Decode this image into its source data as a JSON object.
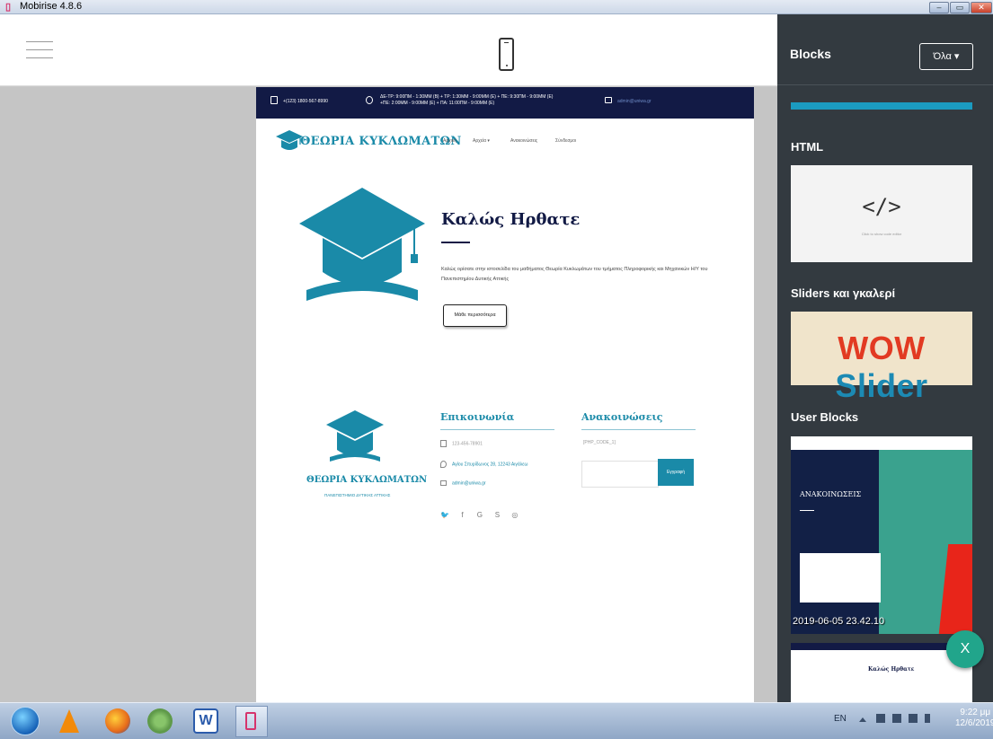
{
  "window": {
    "title": "Mobirise 4.8.6",
    "controls": [
      "minimize-icon",
      "maximize-icon",
      "close-icon"
    ]
  },
  "toolbar": {
    "menu_icon": "hamburger-icon",
    "preview_icon": "mobile-phone-icon"
  },
  "site": {
    "topbar": {
      "phone": "+(123) 1800-567-8990",
      "hours_line1": "ΔΕ-ΤΡ: 9:00ΠΜ - 1:30ΜΜ (Β) + ΤΡ: 1:30ΜΜ - 9:00ΜΜ (Ε) + ΠΕ: 9:30ΠΜ - 9:00ΜΜ (Ε)",
      "hours_line2": "+ΠΕ: 2:00ΜΜ - 9:00ΜΜ (Ε) + ΠΑ: 11:00ΠΜ - 9:00ΜΜ (Ε)",
      "email": "admin@uniwa.gr"
    },
    "brand": "ΘΕΩΡΙΑ ΚΥΚΛΩΜΑΤΩΝ",
    "nav": [
      "Αρχική",
      "Αρχεία ▾",
      "Ανακοινώσεις",
      "Σύνδεσμοι"
    ],
    "hero": {
      "title": "Καλώς Ηρθατε",
      "text": "Καλώς ορίσατε στην ιστοσελίδα του μαθήματος Θεωρία Κυκλωμάτων του τμήματος Πληροφορικής και Μηχανικών Η/Υ του Πανεπιστημίου Δυτικής Αττικής",
      "button": "Μάθε περισσότερα"
    },
    "footer": {
      "brand": "ΘΕΩΡΙΑ ΚΥΚΛΩΜΑΤΩΝ",
      "subtitle": "ΠΑΝΕΠΙΣΤΗΜΙΟ ΔΥΤΙΚΗΣ ΑΤΤΙΚΗΣ",
      "contact_heading": "Επικοινωνία",
      "news_heading": "Ανακοινώσεις",
      "phone": "123-456-78901",
      "address": "Αγίου Σπυρίδωνος 28, 12243 Αιγάλεω",
      "email": "admin@uniwa.gr",
      "news_code": "[PHP_CODE_1]",
      "news_button": "Εγγραφή",
      "social_icons": [
        "twitter-icon",
        "facebook-icon",
        "google-plus-icon",
        "skype-icon",
        "instagram-icon"
      ]
    }
  },
  "panel": {
    "title": "Blocks",
    "filter": "Όλα ▾",
    "sections": {
      "html": "HTML",
      "sliders": "Sliders και γκαλερί",
      "user": "User Blocks"
    },
    "html_card_icon": "</>",
    "html_card_hint": "Click to show code editor",
    "wow_word1": "WOW",
    "wow_word2": "Slider",
    "user_block1_heading": "ΑΝΑΚΟΙΝΩΣΕΙΣ",
    "user_block1_stamp": "2019-06-05 23.42.10",
    "user_block2_title": "Καλώς Ηρθατε",
    "fab": "X"
  },
  "taskbar": {
    "apps": [
      "windows-start-icon",
      "vlc-icon",
      "firefox-icon",
      "chrome-icon",
      "word-icon",
      "mobirise-icon"
    ],
    "word_letter": "W",
    "lang": "EN",
    "time": "9:22 μμ",
    "date": "12/6/2019"
  },
  "colors": {
    "accent": "#1a8aa8",
    "navy": "#121a45",
    "panel": "#333a40",
    "fab": "#21a58b"
  }
}
